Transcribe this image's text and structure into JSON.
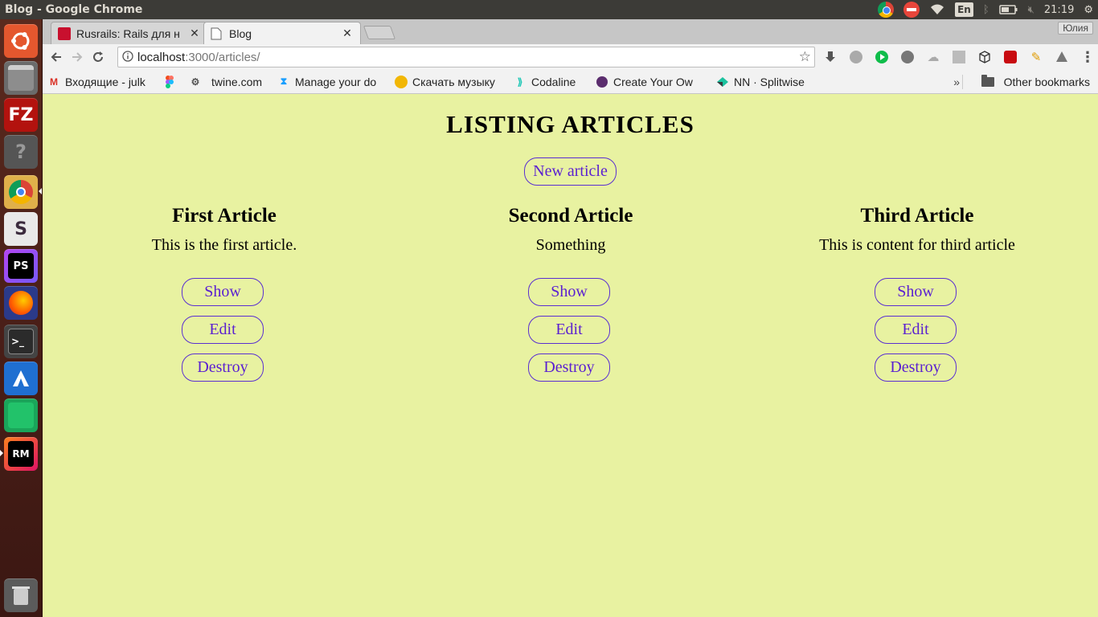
{
  "os": {
    "window_title": "Blog - Google Chrome",
    "lang": "En",
    "clock": "21:19",
    "launcher": [
      {
        "name": "ubuntu-dash-icon"
      },
      {
        "name": "files-icon"
      },
      {
        "name": "filezilla-icon",
        "label": "FZ"
      },
      {
        "name": "help-icon",
        "label": "?"
      },
      {
        "name": "chrome-launcher-icon"
      },
      {
        "name": "slack-icon",
        "label": "S"
      },
      {
        "name": "phpstorm-icon",
        "label": "PS"
      },
      {
        "name": "firefox-icon"
      },
      {
        "name": "terminal-icon",
        "label": ">_"
      },
      {
        "name": "bricscad-icon"
      },
      {
        "name": "app-green-icon"
      },
      {
        "name": "rubymine-icon",
        "label": "RM"
      },
      {
        "name": "trash-icon"
      }
    ]
  },
  "browser": {
    "tabs": [
      {
        "title": "Rusrails: Rails для н",
        "active": false
      },
      {
        "title": "Blog",
        "active": true
      }
    ],
    "profile": "Юлия",
    "url": {
      "host": "localhost",
      "path": ":3000/articles/"
    },
    "bookmarks": [
      {
        "label": "Входящие - julk",
        "icon": "gmail-icon"
      },
      {
        "label": "",
        "icon": "figma-icon"
      },
      {
        "label": "twine.com",
        "icon": "twine-icon"
      },
      {
        "label": "Manage your do",
        "icon": "manage-icon"
      },
      {
        "label": "Скачать музыку",
        "icon": "music-icon"
      },
      {
        "label": "Codaline",
        "icon": "codaline-icon"
      },
      {
        "label": "Create Your Ow",
        "icon": "create-icon"
      },
      {
        "label": "NN · Splitwise",
        "icon": "splitwise-icon"
      }
    ],
    "bookmarks_more": "»",
    "other_bookmarks": "Other bookmarks"
  },
  "page": {
    "title": "LISTING ARTICLES",
    "new_article": "New article",
    "articles": [
      {
        "title": "First Article",
        "text": "This is the first article.",
        "show": "Show",
        "edit": "Edit",
        "destroy": "Destroy"
      },
      {
        "title": "Second Article",
        "text": "Something",
        "show": "Show",
        "edit": "Edit",
        "destroy": "Destroy"
      },
      {
        "title": "Third Article",
        "text": "This is content for third article",
        "show": "Show",
        "edit": "Edit",
        "destroy": "Destroy"
      }
    ]
  },
  "colors": {
    "page_bg": "#e8f2a1",
    "link": "#5a1fd1"
  }
}
